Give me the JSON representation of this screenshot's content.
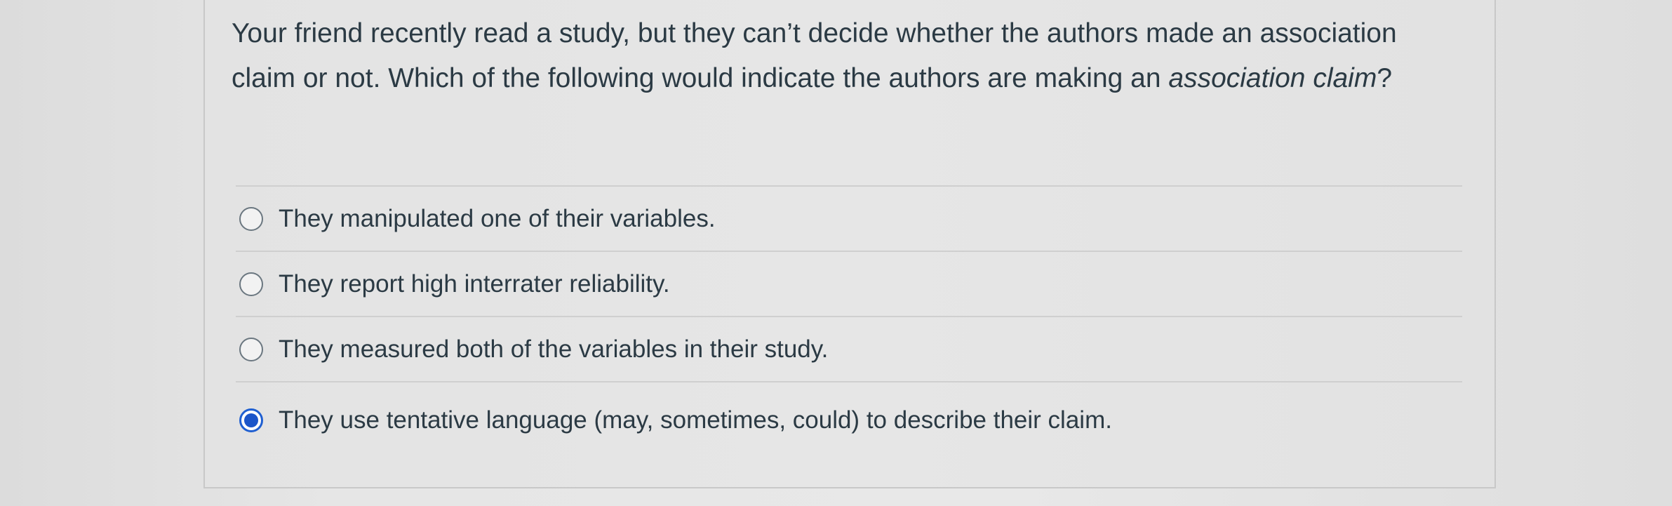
{
  "question": {
    "text_main": "Your friend recently read a study, but they can’t decide whether the authors made an association claim or not. Which of the following would indicate the authors are making an ",
    "text_emphasis": "association claim",
    "text_end": "?"
  },
  "answers": [
    {
      "label": "They manipulated one of their variables.",
      "selected": false
    },
    {
      "label": "They report high interrater reliability.",
      "selected": false
    },
    {
      "label": "They measured both of the variables in their study.",
      "selected": false
    },
    {
      "label": "They use tentative language (may, sometimes, could) to describe their claim.",
      "selected": true
    }
  ],
  "colors": {
    "accent": "#1b55c9",
    "text": "#2b3a44",
    "background": "#e4e4e4"
  }
}
